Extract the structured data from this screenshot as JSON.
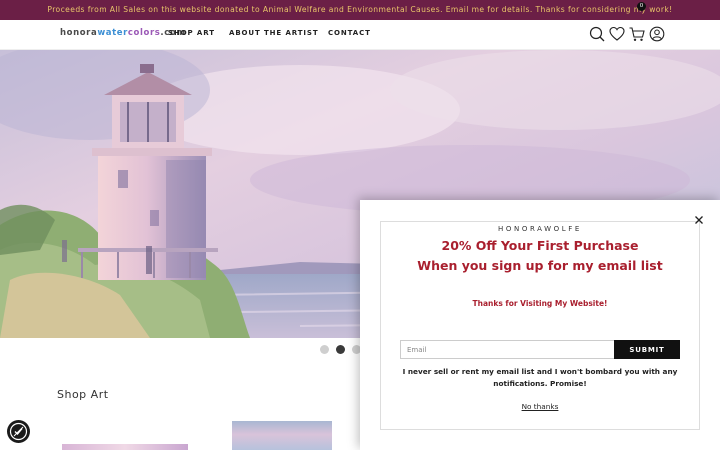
{
  "announcement": "Proceeds from All Sales on this website donated to Animal Welfare and Environmental Causes. Email me for details. Thanks for considering my work!",
  "logo": {
    "part1": "honora",
    "part2": "water",
    "part3": "colors",
    "part4": ".com"
  },
  "nav": {
    "shop_art": "SHOP ART",
    "about": "ABOUT THE ARTIST",
    "contact": "CONTACT"
  },
  "header_icons": [
    "search-icon",
    "heart-icon",
    "cart-icon",
    "account-icon"
  ],
  "cart": {
    "count": "0"
  },
  "hero": {
    "slides": 3,
    "active_slide": 2
  },
  "shop": {
    "title": "Shop Art"
  },
  "popup": {
    "brand": "HONORAWOLFE",
    "headline1": "20% Off Your First Purchase",
    "headline2": "When you sign up for my email list",
    "subtext": "Thanks for Visiting My Website!",
    "email_placeholder": "Email",
    "email_value": "",
    "submit_label": "SUBMIT",
    "disclaimer": "I never sell or rent my email list and I won't bombard you with any notifications. Promise!",
    "no_thanks": "No thanks"
  },
  "colors": {
    "announcement_bg": "#6b1f46",
    "announcement_text": "#e9c56a",
    "accent_red": "#a91f2e",
    "logo_blue": "#3c8fd4",
    "logo_purple": "#9b59b6",
    "button_bg": "#111111"
  }
}
